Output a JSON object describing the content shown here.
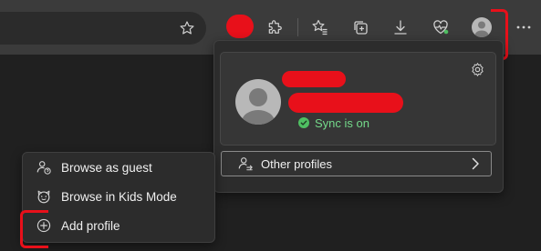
{
  "toolbar": {
    "icons": [
      "star-icon",
      "extensions-icon",
      "favorites-icon",
      "collections-icon",
      "downloads-icon",
      "browser-essentials-icon",
      "profile-avatar-icon",
      "more-options-icon"
    ]
  },
  "profile_flyout": {
    "settings_icon": "gear-icon",
    "sync_status": "Sync is on",
    "other_profiles_label": "Other profiles"
  },
  "context_menu": {
    "items": [
      {
        "label": "Browse as guest",
        "icon": "guest-icon"
      },
      {
        "label": "Browse in Kids Mode",
        "icon": "kids-mode-icon"
      },
      {
        "label": "Add profile",
        "icon": "add-circle-icon"
      }
    ]
  },
  "colors": {
    "background": "#202020",
    "toolbar": "#3b3b3b",
    "panel": "#2c2c2c",
    "sync_green": "#4fbf62",
    "annotation_red": "#e8101a"
  }
}
